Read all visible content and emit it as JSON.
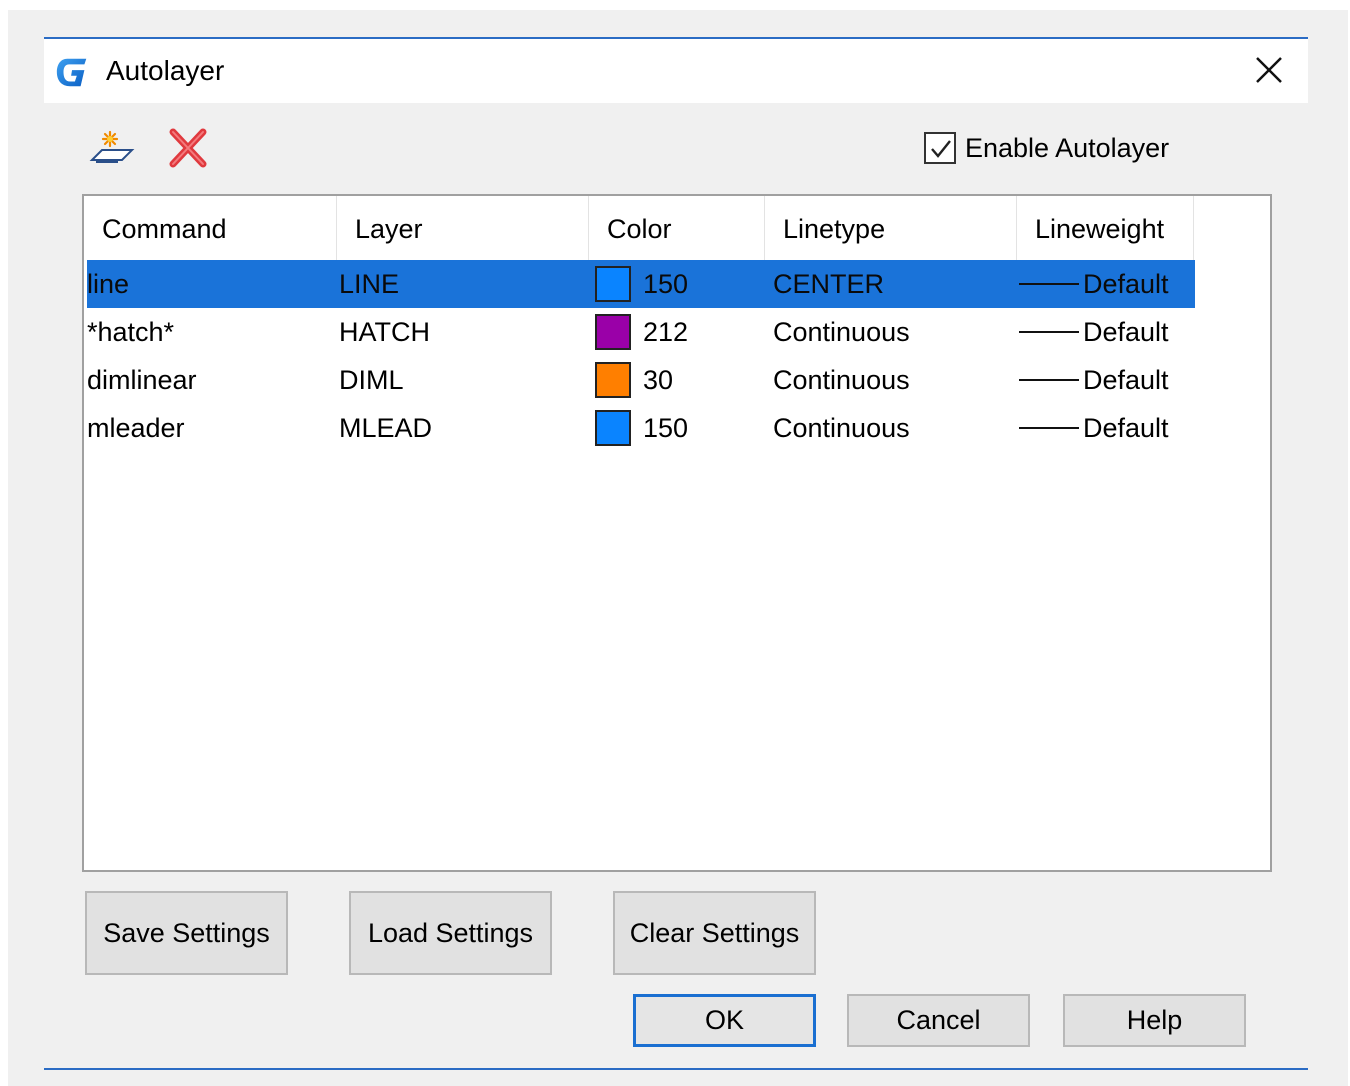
{
  "window": {
    "title": "Autolayer"
  },
  "toolbar": {
    "new_icon": "new-layer-sparkle-icon",
    "delete_icon": "red-x-delete-icon",
    "enable_label": "Enable Autolayer",
    "enable_checked": true
  },
  "table": {
    "columns": [
      "Command",
      "Layer",
      "Color",
      "Linetype",
      "Lineweight"
    ],
    "rows": [
      {
        "command": "line",
        "layer": "LINE",
        "color_hex": "#0a84ff",
        "color_index": "150",
        "linetype": "CENTER",
        "lineweight": "Default",
        "selected": true
      },
      {
        "command": "*hatch*",
        "layer": "HATCH",
        "color_hex": "#9a00a8",
        "color_index": "212",
        "linetype": "Continuous",
        "lineweight": "Default",
        "selected": false
      },
      {
        "command": "dimlinear",
        "layer": "DIML",
        "color_hex": "#ff7f00",
        "color_index": "30",
        "linetype": "Continuous",
        "lineweight": "Default",
        "selected": false
      },
      {
        "command": "mleader",
        "layer": "MLEAD",
        "color_hex": "#0a84ff",
        "color_index": "150",
        "linetype": "Continuous",
        "lineweight": "Default",
        "selected": false
      }
    ]
  },
  "buttons": {
    "save": "Save Settings",
    "load": "Load Settings",
    "clear": "Clear Settings",
    "ok": "OK",
    "cancel": "Cancel",
    "help": "Help"
  },
  "colors": {
    "accent": "#2b6cc4",
    "selection": "#1a73d9",
    "delete_red": "#e0393e"
  }
}
